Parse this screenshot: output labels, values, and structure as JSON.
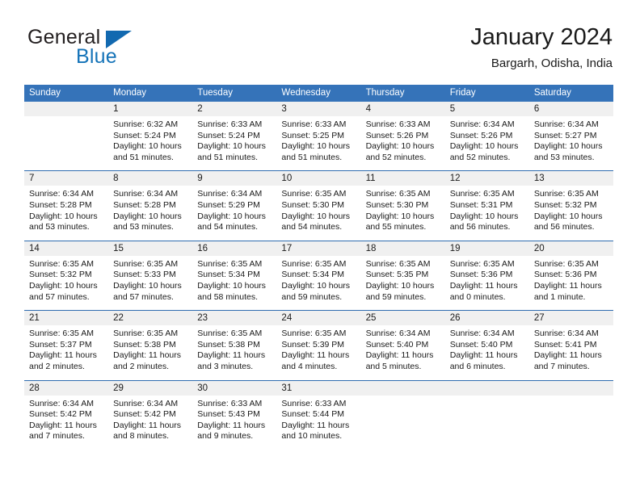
{
  "brand": {
    "name_part1": "General",
    "name_part2": "Blue",
    "logo_icon": "blue-triangle-icon"
  },
  "header": {
    "title": "January 2024",
    "subtitle": "Bargarh, Odisha, India"
  },
  "colors": {
    "header_blue": "#3573b9",
    "brand_blue": "#1473b8",
    "daynum_band": "#f0f0f0",
    "week_divider": "#2f6cb0",
    "text": "#1a1a1a"
  },
  "weekdays": [
    "Sunday",
    "Monday",
    "Tuesday",
    "Wednesday",
    "Thursday",
    "Friday",
    "Saturday"
  ],
  "weeks": [
    [
      {
        "day": "",
        "sunrise": "",
        "sunset": "",
        "daylight_line1": "",
        "daylight_line2": "",
        "empty": true
      },
      {
        "day": "1",
        "sunrise": "Sunrise: 6:32 AM",
        "sunset": "Sunset: 5:24 PM",
        "daylight_line1": "Daylight: 10 hours",
        "daylight_line2": "and 51 minutes."
      },
      {
        "day": "2",
        "sunrise": "Sunrise: 6:33 AM",
        "sunset": "Sunset: 5:24 PM",
        "daylight_line1": "Daylight: 10 hours",
        "daylight_line2": "and 51 minutes."
      },
      {
        "day": "3",
        "sunrise": "Sunrise: 6:33 AM",
        "sunset": "Sunset: 5:25 PM",
        "daylight_line1": "Daylight: 10 hours",
        "daylight_line2": "and 51 minutes."
      },
      {
        "day": "4",
        "sunrise": "Sunrise: 6:33 AM",
        "sunset": "Sunset: 5:26 PM",
        "daylight_line1": "Daylight: 10 hours",
        "daylight_line2": "and 52 minutes."
      },
      {
        "day": "5",
        "sunrise": "Sunrise: 6:34 AM",
        "sunset": "Sunset: 5:26 PM",
        "daylight_line1": "Daylight: 10 hours",
        "daylight_line2": "and 52 minutes."
      },
      {
        "day": "6",
        "sunrise": "Sunrise: 6:34 AM",
        "sunset": "Sunset: 5:27 PM",
        "daylight_line1": "Daylight: 10 hours",
        "daylight_line2": "and 53 minutes."
      }
    ],
    [
      {
        "day": "7",
        "sunrise": "Sunrise: 6:34 AM",
        "sunset": "Sunset: 5:28 PM",
        "daylight_line1": "Daylight: 10 hours",
        "daylight_line2": "and 53 minutes."
      },
      {
        "day": "8",
        "sunrise": "Sunrise: 6:34 AM",
        "sunset": "Sunset: 5:28 PM",
        "daylight_line1": "Daylight: 10 hours",
        "daylight_line2": "and 53 minutes."
      },
      {
        "day": "9",
        "sunrise": "Sunrise: 6:34 AM",
        "sunset": "Sunset: 5:29 PM",
        "daylight_line1": "Daylight: 10 hours",
        "daylight_line2": "and 54 minutes."
      },
      {
        "day": "10",
        "sunrise": "Sunrise: 6:35 AM",
        "sunset": "Sunset: 5:30 PM",
        "daylight_line1": "Daylight: 10 hours",
        "daylight_line2": "and 54 minutes."
      },
      {
        "day": "11",
        "sunrise": "Sunrise: 6:35 AM",
        "sunset": "Sunset: 5:30 PM",
        "daylight_line1": "Daylight: 10 hours",
        "daylight_line2": "and 55 minutes."
      },
      {
        "day": "12",
        "sunrise": "Sunrise: 6:35 AM",
        "sunset": "Sunset: 5:31 PM",
        "daylight_line1": "Daylight: 10 hours",
        "daylight_line2": "and 56 minutes."
      },
      {
        "day": "13",
        "sunrise": "Sunrise: 6:35 AM",
        "sunset": "Sunset: 5:32 PM",
        "daylight_line1": "Daylight: 10 hours",
        "daylight_line2": "and 56 minutes."
      }
    ],
    [
      {
        "day": "14",
        "sunrise": "Sunrise: 6:35 AM",
        "sunset": "Sunset: 5:32 PM",
        "daylight_line1": "Daylight: 10 hours",
        "daylight_line2": "and 57 minutes."
      },
      {
        "day": "15",
        "sunrise": "Sunrise: 6:35 AM",
        "sunset": "Sunset: 5:33 PM",
        "daylight_line1": "Daylight: 10 hours",
        "daylight_line2": "and 57 minutes."
      },
      {
        "day": "16",
        "sunrise": "Sunrise: 6:35 AM",
        "sunset": "Sunset: 5:34 PM",
        "daylight_line1": "Daylight: 10 hours",
        "daylight_line2": "and 58 minutes."
      },
      {
        "day": "17",
        "sunrise": "Sunrise: 6:35 AM",
        "sunset": "Sunset: 5:34 PM",
        "daylight_line1": "Daylight: 10 hours",
        "daylight_line2": "and 59 minutes."
      },
      {
        "day": "18",
        "sunrise": "Sunrise: 6:35 AM",
        "sunset": "Sunset: 5:35 PM",
        "daylight_line1": "Daylight: 10 hours",
        "daylight_line2": "and 59 minutes."
      },
      {
        "day": "19",
        "sunrise": "Sunrise: 6:35 AM",
        "sunset": "Sunset: 5:36 PM",
        "daylight_line1": "Daylight: 11 hours",
        "daylight_line2": "and 0 minutes."
      },
      {
        "day": "20",
        "sunrise": "Sunrise: 6:35 AM",
        "sunset": "Sunset: 5:36 PM",
        "daylight_line1": "Daylight: 11 hours",
        "daylight_line2": "and 1 minute."
      }
    ],
    [
      {
        "day": "21",
        "sunrise": "Sunrise: 6:35 AM",
        "sunset": "Sunset: 5:37 PM",
        "daylight_line1": "Daylight: 11 hours",
        "daylight_line2": "and 2 minutes."
      },
      {
        "day": "22",
        "sunrise": "Sunrise: 6:35 AM",
        "sunset": "Sunset: 5:38 PM",
        "daylight_line1": "Daylight: 11 hours",
        "daylight_line2": "and 2 minutes."
      },
      {
        "day": "23",
        "sunrise": "Sunrise: 6:35 AM",
        "sunset": "Sunset: 5:38 PM",
        "daylight_line1": "Daylight: 11 hours",
        "daylight_line2": "and 3 minutes."
      },
      {
        "day": "24",
        "sunrise": "Sunrise: 6:35 AM",
        "sunset": "Sunset: 5:39 PM",
        "daylight_line1": "Daylight: 11 hours",
        "daylight_line2": "and 4 minutes."
      },
      {
        "day": "25",
        "sunrise": "Sunrise: 6:34 AM",
        "sunset": "Sunset: 5:40 PM",
        "daylight_line1": "Daylight: 11 hours",
        "daylight_line2": "and 5 minutes."
      },
      {
        "day": "26",
        "sunrise": "Sunrise: 6:34 AM",
        "sunset": "Sunset: 5:40 PM",
        "daylight_line1": "Daylight: 11 hours",
        "daylight_line2": "and 6 minutes."
      },
      {
        "day": "27",
        "sunrise": "Sunrise: 6:34 AM",
        "sunset": "Sunset: 5:41 PM",
        "daylight_line1": "Daylight: 11 hours",
        "daylight_line2": "and 7 minutes."
      }
    ],
    [
      {
        "day": "28",
        "sunrise": "Sunrise: 6:34 AM",
        "sunset": "Sunset: 5:42 PM",
        "daylight_line1": "Daylight: 11 hours",
        "daylight_line2": "and 7 minutes."
      },
      {
        "day": "29",
        "sunrise": "Sunrise: 6:34 AM",
        "sunset": "Sunset: 5:42 PM",
        "daylight_line1": "Daylight: 11 hours",
        "daylight_line2": "and 8 minutes."
      },
      {
        "day": "30",
        "sunrise": "Sunrise: 6:33 AM",
        "sunset": "Sunset: 5:43 PM",
        "daylight_line1": "Daylight: 11 hours",
        "daylight_line2": "and 9 minutes."
      },
      {
        "day": "31",
        "sunrise": "Sunrise: 6:33 AM",
        "sunset": "Sunset: 5:44 PM",
        "daylight_line1": "Daylight: 11 hours",
        "daylight_line2": "and 10 minutes."
      },
      {
        "day": "",
        "sunrise": "",
        "sunset": "",
        "daylight_line1": "",
        "daylight_line2": "",
        "empty": true
      },
      {
        "day": "",
        "sunrise": "",
        "sunset": "",
        "daylight_line1": "",
        "daylight_line2": "",
        "empty": true
      },
      {
        "day": "",
        "sunrise": "",
        "sunset": "",
        "daylight_line1": "",
        "daylight_line2": "",
        "empty": true
      }
    ]
  ]
}
